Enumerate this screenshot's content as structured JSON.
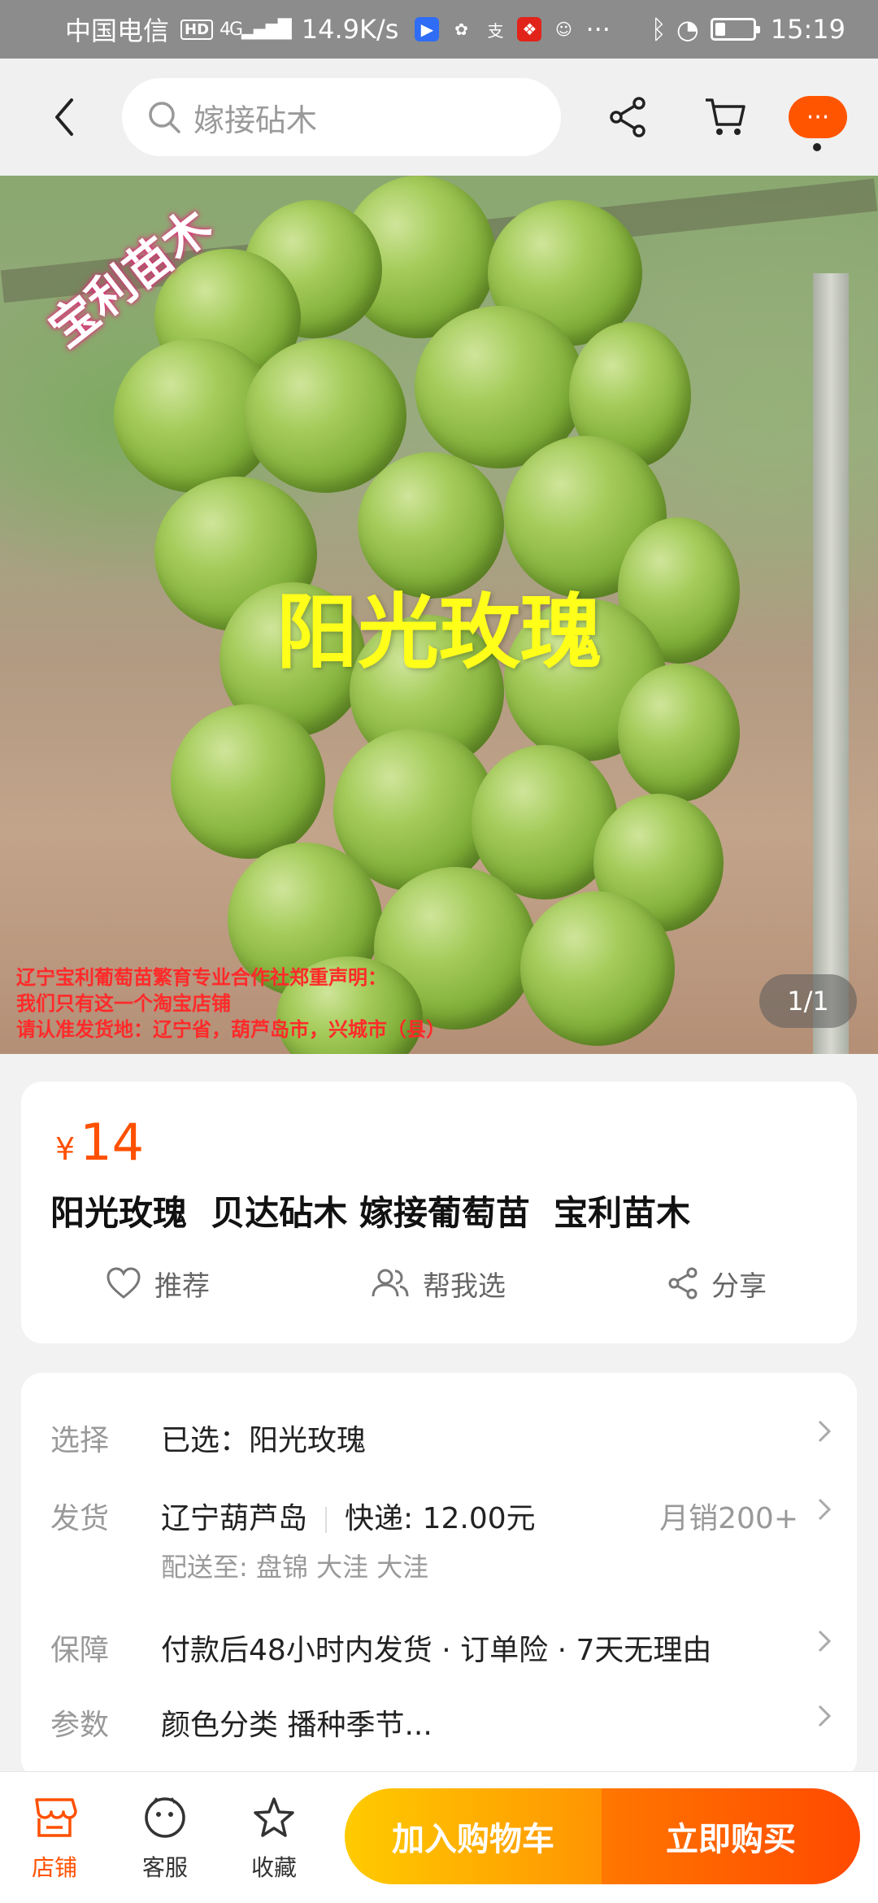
{
  "status_bar": {
    "carrier": "中国电信",
    "hd": "HD",
    "network": "4G",
    "speed": "14.9K/s",
    "more": "···",
    "time": "15:19"
  },
  "header": {
    "search_placeholder": "嫁接砧木"
  },
  "hero": {
    "brand_watermark": "宝利苗木",
    "variety": "阳光玫瑰",
    "notice_lines": [
      "辽宁宝利葡萄苗繁育专业合作社郑重声明：",
      "我们只有这一个淘宝店铺",
      "请认准发货地：辽宁省，葫芦岛市，兴城市（县）"
    ],
    "counter": "1/1"
  },
  "product": {
    "currency": "¥",
    "price": "14",
    "title": "阳光玫瑰  贝达砧木 嫁接葡萄苗  宝利苗木",
    "actions": {
      "recommend": "推荐",
      "help_choose": "帮我选",
      "share": "分享"
    }
  },
  "info": {
    "select": {
      "label": "选择",
      "value": "已选：阳光玫瑰"
    },
    "ship": {
      "label": "发货",
      "origin": "辽宁葫芦岛",
      "express": "快递: 12.00元",
      "sales": "月销200+",
      "deliver_to": "配送至: 盘锦 大洼 大洼"
    },
    "guarantee": {
      "label": "保障",
      "value": "付款后48小时内发货 · 订单险 · 7天无理由"
    },
    "params": {
      "label": "参数",
      "value": "颜色分类 播种季节..."
    }
  },
  "bottom_bar": {
    "store": "店铺",
    "service": "客服",
    "favorite": "收藏",
    "add_to_cart": "加入购物车",
    "buy_now": "立即购买"
  },
  "colors": {
    "accent": "#ff5000",
    "cart_gradient": [
      "#ffcb00",
      "#ff9402"
    ],
    "buy_gradient": [
      "#ff7700",
      "#ff4900"
    ]
  }
}
